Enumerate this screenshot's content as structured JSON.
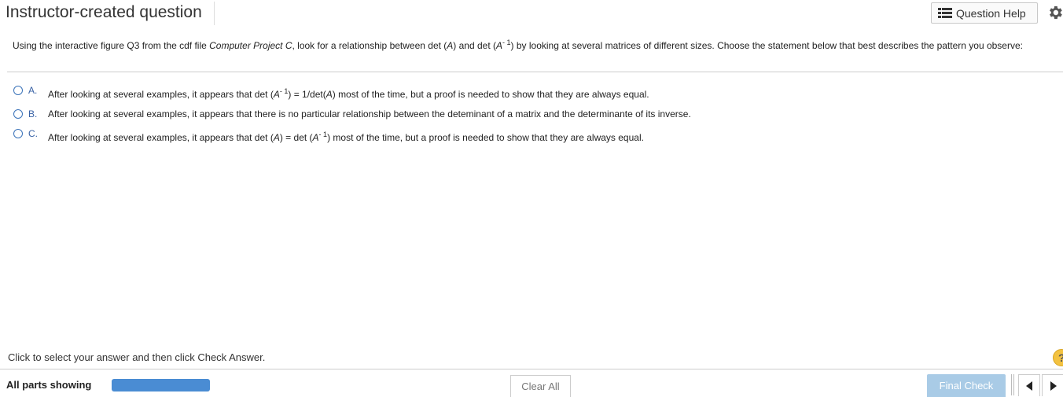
{
  "header": {
    "title": "Instructor-created question",
    "help_button_label": "Question Help"
  },
  "question": {
    "part1": "Using the interactive figure Q3 from the cdf file ",
    "project": "Computer Project C",
    "part2": ",  look for a relationship between det (",
    "a1": "A",
    "part3": ") and det (",
    "a2": "A",
    "exp": "- 1",
    "part4": ") by looking at several matrices of different sizes.   Choose the statement below that best describes the pattern you observe:"
  },
  "options": [
    {
      "letter": "A.",
      "pre": "After looking at several examples, it appears that det (",
      "a": "A",
      "exp": "- 1",
      "mid": ") = 1/det(",
      "a2": "A",
      "post": ") most of the time, but a proof is needed to show that they are always equal."
    },
    {
      "letter": "B.",
      "text": "After looking at several examples, it appears that there is no particular relationship between the deteminant of a matrix and the determinante of  its inverse."
    },
    {
      "letter": "C.",
      "pre": "After looking at several examples, it appears that det (",
      "a": "A",
      "mid": ") = det (",
      "a2": "A",
      "exp": "- 1",
      "post": ") most of the time, but a proof is needed to show that they are always equal."
    }
  ],
  "footer": {
    "instruction": "Click to select your answer and then click Check Answer.",
    "help_glyph": "?",
    "parts_label": "All parts showing",
    "progress_fraction": 1.0,
    "clear_label": "Clear All",
    "final_label": "Final Check"
  },
  "colors": {
    "accent": "#3a63a6",
    "progress": "#4a8cd3",
    "final_button": "#a9cbe6",
    "help_circle": "#f3c240"
  }
}
